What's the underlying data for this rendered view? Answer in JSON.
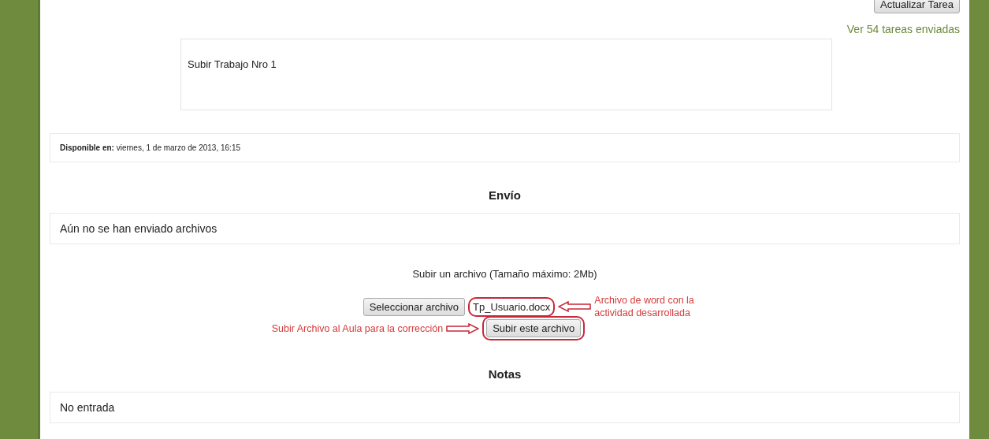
{
  "top_button": "Actualizar Tarea",
  "submissions_link": "Ver 54 tareas enviadas",
  "description": "Subir Trabajo Nro 1",
  "available": {
    "label": "Disponible en:",
    "value": "viernes, 1 de marzo de 2013, 16:15"
  },
  "submission": {
    "heading": "Envío",
    "status": "Aún no se han enviado archivos"
  },
  "upload": {
    "title": "Subir un archivo (Tamaño máximo: 2Mb)",
    "select_button": "Seleccionar archivo",
    "file_name": "Tp_Usuario.docx",
    "submit_button": "Subir este archivo"
  },
  "annotations": [
    {
      "kind": "file",
      "text": "Archivo de word con la actividad desarrollada"
    },
    {
      "kind": "submit",
      "text": "Subir Archivo al Aula para la corrección"
    }
  ],
  "grades": {
    "heading": "Notas",
    "status": "No entrada"
  }
}
